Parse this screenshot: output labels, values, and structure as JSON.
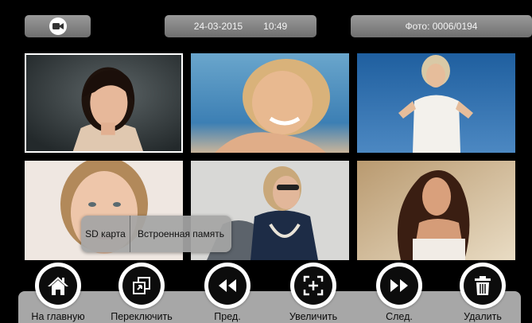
{
  "topbar": {
    "date": "24-03-2015",
    "time": "10:49",
    "photo_counter": "Фото: 0006/0194",
    "camera_icon": "video-camera-icon"
  },
  "gallery": {
    "selected_index": 0,
    "count": 6
  },
  "storage_menu": {
    "options": [
      "SD карта",
      "Встроенная память"
    ]
  },
  "controls": [
    {
      "label": "На главную",
      "icon": "home-icon"
    },
    {
      "label": "Переключить",
      "icon": "switch-windows-icon"
    },
    {
      "label": "Пред.",
      "icon": "rewind-icon"
    },
    {
      "label": "Увеличить",
      "icon": "zoom-icon"
    },
    {
      "label": "След.",
      "icon": "fast-forward-icon"
    },
    {
      "label": "Удалить",
      "icon": "trash-icon"
    }
  ],
  "colors": {
    "background": "#000000",
    "pill": "#8a8a8a",
    "bar": "#a7a7a7"
  }
}
